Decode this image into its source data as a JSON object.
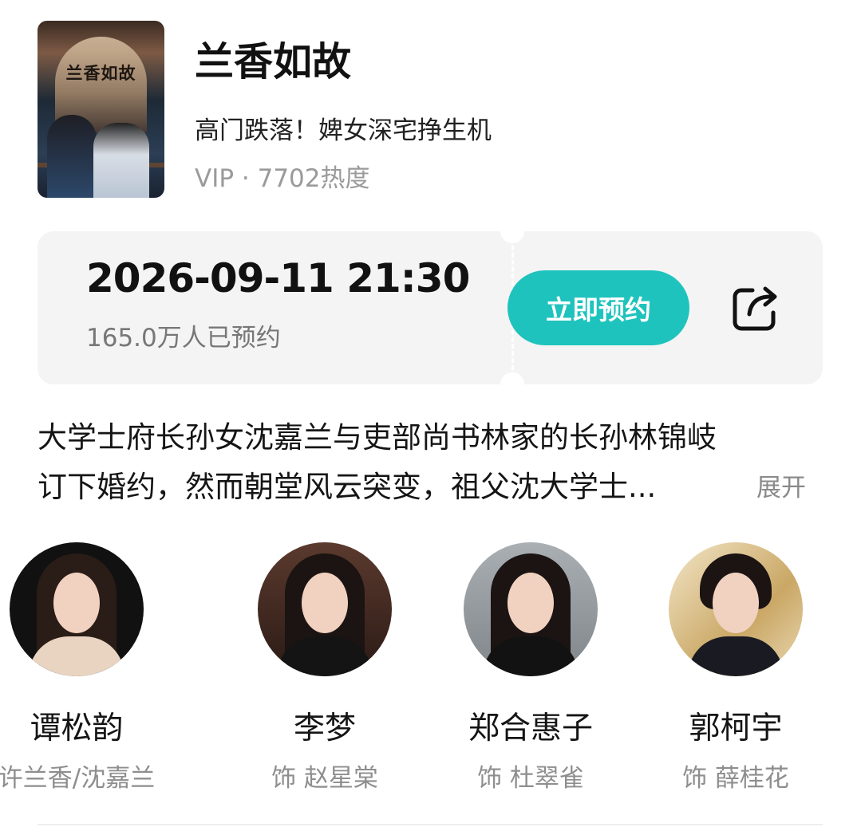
{
  "show": {
    "poster_title": "兰香如故",
    "title": "兰香如故",
    "subtitle": "高门跌落！婢女深宅挣生机",
    "meta": "VIP · 7702热度"
  },
  "reservation": {
    "datetime": "2026-09-11 21:30",
    "count": "165.0万人已预约",
    "button_label": "立即预约",
    "accent": "#1fc3bd"
  },
  "description": {
    "line1": "大学士府长孙女沈嘉兰与吏部尚书林家的长孙林锦岐",
    "line2": "订下婚约，然而朝堂风云突变，祖父沈大学士...",
    "expand_label": "展开"
  },
  "cast": [
    {
      "name": "谭松韵",
      "role": "许兰香/沈嘉兰"
    },
    {
      "name": "李梦",
      "role": "饰 赵星棠"
    },
    {
      "name": "郑合惠子",
      "role": "饰 杜翠雀"
    },
    {
      "name": "郭柯宇",
      "role": "饰 薛桂花"
    }
  ]
}
